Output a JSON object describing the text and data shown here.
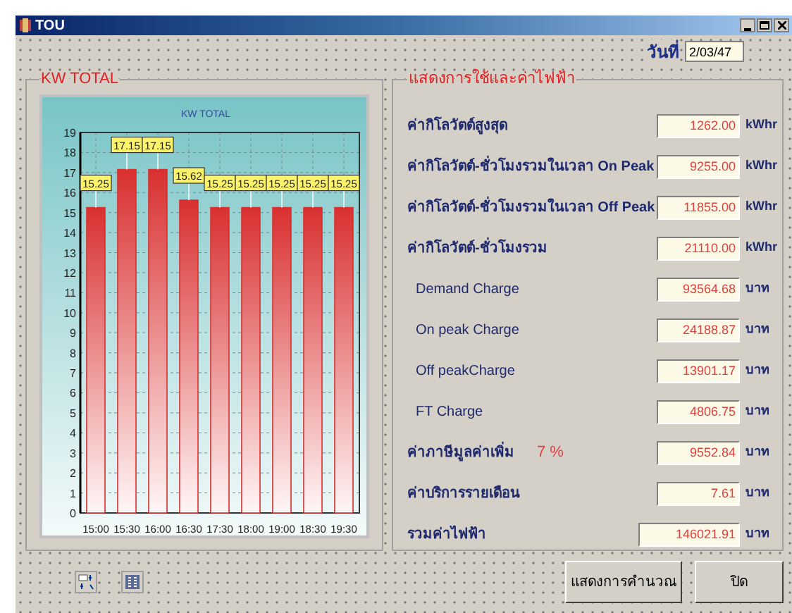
{
  "window": {
    "title": "TOU"
  },
  "date": {
    "label": "วันที่",
    "value": "2/03/47"
  },
  "chart_panel": {
    "title": "KW TOTAL",
    "chart_data": {
      "type": "bar",
      "title": "KW TOTAL",
      "categories": [
        "15:00",
        "15:30",
        "16:00",
        "16:30",
        "17:30",
        "18:00",
        "19:00",
        "18:30",
        "19:30"
      ],
      "series": [
        {
          "color": "#d93030",
          "values": [
            15.25,
            17.15,
            17.15,
            15.62,
            15.25,
            15.25,
            15.25,
            15.25,
            15.25
          ]
        }
      ],
      "ylim": [
        0,
        19
      ],
      "yticks": [
        0,
        1,
        2,
        3,
        4,
        5,
        6,
        7,
        8,
        9,
        10,
        11,
        12,
        13,
        14,
        15,
        16,
        17,
        18,
        19
      ],
      "data_labels": true,
      "grid": true
    }
  },
  "summary_panel": {
    "title": "แสดงการใช้และค่าไฟฟ้า",
    "rows": [
      {
        "label": "ค่ากิโลวัตต์สูงสุด",
        "value": "1262.00",
        "unit": "kWhr"
      },
      {
        "label": "ค่ากิโลวัตต์-ชั่วโมงรวมในเวลา On Peak",
        "value": "9255.00",
        "unit": "kWhr"
      },
      {
        "label": "ค่ากิโลวัตต์-ชั่วโมงรวมในเวลา Off Peak",
        "value": "11855.00",
        "unit": "kWhr"
      },
      {
        "label": "ค่ากิโลวัตต์-ชั่วโมงรวม",
        "value": "21110.00",
        "unit": "kWhr"
      },
      {
        "label": "Demand Charge",
        "value": "93564.68",
        "unit": "บาท"
      },
      {
        "label": "On peak Charge",
        "value": "24188.87",
        "unit": "บาท"
      },
      {
        "label": "Off peakCharge",
        "value": "13901.17",
        "unit": "บาท"
      },
      {
        "label": "FT Charge",
        "value": "4806.75",
        "unit": "บาท"
      },
      {
        "label": "ค่าภาษีมูลค่าเพิ่ม",
        "note": "7 %",
        "value": "9552.84",
        "unit": "บาท"
      },
      {
        "label": "ค่าบริการรายเดือน",
        "value": "7.61",
        "unit": "บาท"
      },
      {
        "label": "รวมค่าไฟฟ้า",
        "value": "146021.91",
        "unit": "บาท",
        "kind": "total"
      }
    ]
  },
  "buttons": [
    "แสดงการคำนวณ",
    "ปิด"
  ]
}
